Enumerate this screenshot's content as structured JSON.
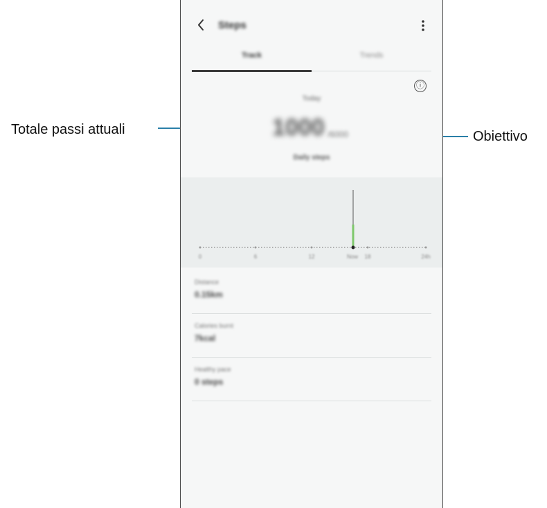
{
  "callouts": {
    "left": "Totale passi attuali",
    "right": "Obiettivo"
  },
  "appbar": {
    "title": "Steps"
  },
  "tabs": [
    {
      "label": "Track",
      "active": true
    },
    {
      "label": "Trends",
      "active": false
    }
  ],
  "info_icon": "ⓘ",
  "summary": {
    "date_label": "Today",
    "steps_value": "1000",
    "goal_value": "/6000",
    "daily_label": "Daily steps"
  },
  "chart_data": {
    "type": "bar",
    "x_ticks": [
      "0",
      "6",
      "12",
      "Now",
      "18",
      "24h"
    ],
    "current_bar_value": 1,
    "current_marker": "Now",
    "colors": {
      "bar": "#7ec86b",
      "line": "#555555",
      "background": "#ebeeee"
    }
  },
  "stats": [
    {
      "label": "Distance",
      "value": "0.15km"
    },
    {
      "label": "Calories burnt",
      "value": "7kcal"
    },
    {
      "label": "Healthy pace",
      "value": "0 steps"
    }
  ],
  "colors": {
    "accent_line": "#2a7fa8",
    "tab_indicator": "#3a3a3a",
    "phone_bg": "#f6f7f7"
  }
}
